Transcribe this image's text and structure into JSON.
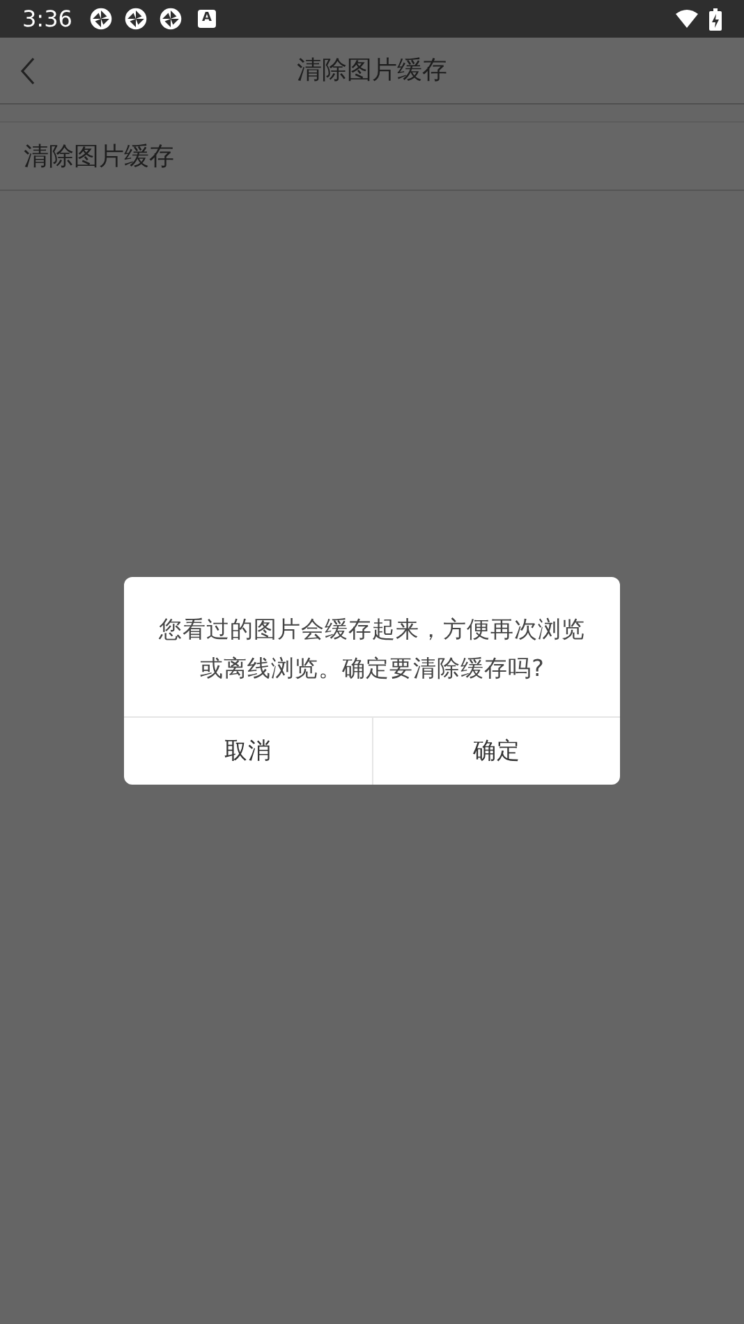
{
  "status_bar": {
    "time": "3:36",
    "notification_icons": [
      {
        "kind": "aperture"
      },
      {
        "kind": "aperture"
      },
      {
        "kind": "aperture"
      },
      {
        "kind": "letter",
        "label": "A"
      }
    ]
  },
  "header": {
    "title": "清除图片缓存"
  },
  "settings": [
    {
      "label": "清除图片缓存"
    }
  ],
  "dialog": {
    "message": "您看过的图片会缓存起来，方便再次浏览或离线浏览。确定要清除缓存吗?",
    "buttons": [
      "取消",
      "确定"
    ]
  }
}
